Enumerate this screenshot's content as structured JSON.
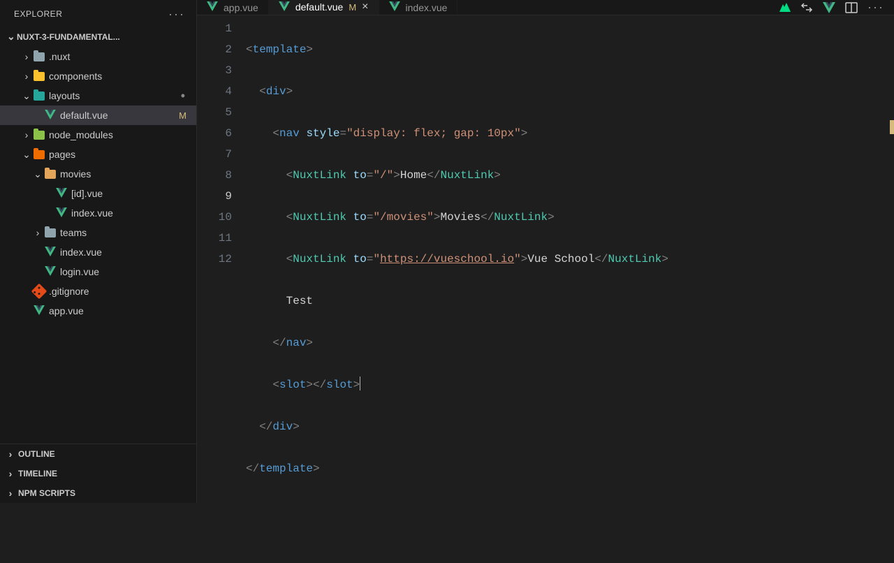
{
  "sidebar": {
    "title": "EXPLORER",
    "project": "NUXT-3-FUNDAMENTAL...",
    "tree": [
      {
        "label": ".nuxt",
        "type": "folder-gray",
        "indent": 1,
        "expanded": false
      },
      {
        "label": "components",
        "type": "folder-gold",
        "indent": 1,
        "expanded": false
      },
      {
        "label": "layouts",
        "type": "folder-teal",
        "indent": 1,
        "expanded": true,
        "dot": true
      },
      {
        "label": "default.vue",
        "type": "vue",
        "indent": 2,
        "active": true,
        "git": "M"
      },
      {
        "label": "node_modules",
        "type": "folder-green",
        "indent": 1,
        "expanded": false
      },
      {
        "label": "pages",
        "type": "folder-orange2",
        "indent": 1,
        "expanded": true
      },
      {
        "label": "movies",
        "type": "folder-orange",
        "indent": 2,
        "expanded": true
      },
      {
        "label": "[id].vue",
        "type": "vue",
        "indent": 3
      },
      {
        "label": "index.vue",
        "type": "vue",
        "indent": 3
      },
      {
        "label": "teams",
        "type": "folder-gray",
        "indent": 2,
        "expanded": false
      },
      {
        "label": "index.vue",
        "type": "vue",
        "indent": 2
      },
      {
        "label": "login.vue",
        "type": "vue",
        "indent": 2
      },
      {
        "label": ".gitignore",
        "type": "git",
        "indent": 1
      },
      {
        "label": "app.vue",
        "type": "vue",
        "indent": 1
      }
    ],
    "sections": [
      "OUTLINE",
      "TIMELINE",
      "NPM SCRIPTS"
    ]
  },
  "tabs": [
    {
      "label": "app.vue",
      "active": false
    },
    {
      "label": "default.vue",
      "active": true,
      "git": "M",
      "close": true
    },
    {
      "label": "index.vue",
      "active": false
    }
  ],
  "editor": {
    "current_line": 9,
    "lines": 12
  },
  "code": {
    "l1_tag": "template",
    "l2_tag": "div",
    "l3_tag": "nav",
    "l3_attr": "style",
    "l3_val": "\"display: flex; gap: 10px\"",
    "l4_comp": "NuxtLink",
    "l4_attr": "to",
    "l4_val": "\"/\"",
    "l4_text": "Home",
    "l5_comp": "NuxtLink",
    "l5_attr": "to",
    "l5_val": "\"/movies\"",
    "l5_text": "Movies",
    "l6_comp": "NuxtLink",
    "l6_attr": "to",
    "l6_url": "https://vueschool.io",
    "l6_text": "Vue School",
    "l7_text": "Test",
    "l8_tag": "nav",
    "l9_tag": "slot",
    "l10_tag": "div",
    "l11_tag": "template"
  }
}
